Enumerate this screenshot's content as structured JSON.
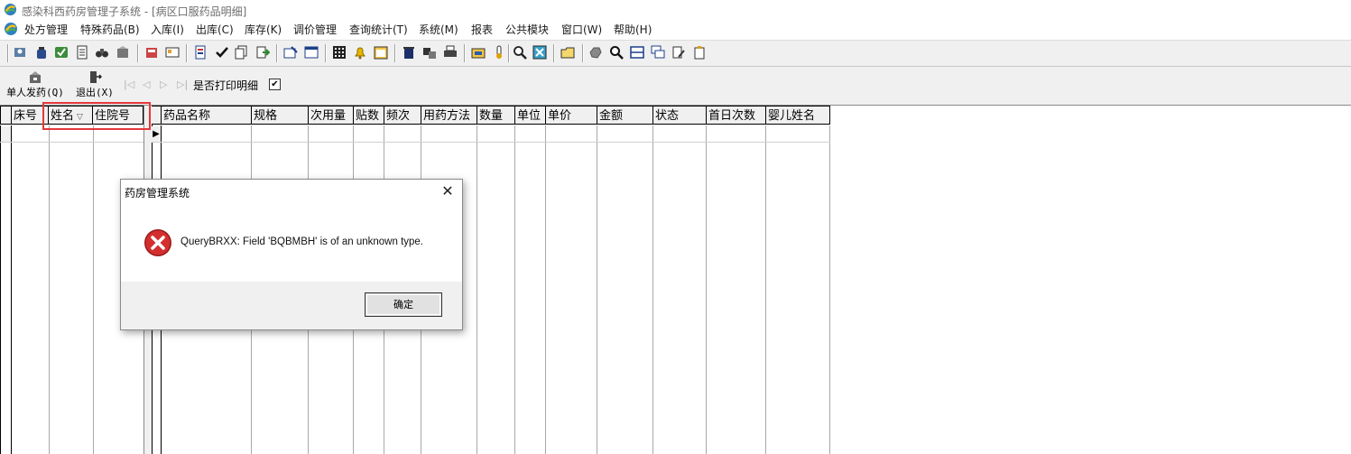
{
  "window": {
    "title": "感染科西药房管理子系统 - [病区口服药品明细]",
    "app_icon": "app-logo-icon"
  },
  "menu": [
    {
      "label": "处方管理"
    },
    {
      "label": "特殊药品(B)"
    },
    {
      "label": "入库(I)"
    },
    {
      "label": "出库(C)"
    },
    {
      "label": "库存(K)"
    },
    {
      "label": "调价管理"
    },
    {
      "label": "查询统计(T)"
    },
    {
      "label": "系统(M)"
    },
    {
      "label": "报表"
    },
    {
      "label": "公共模块"
    },
    {
      "label": "窗口(W)"
    },
    {
      "label": "帮助(H)"
    }
  ],
  "actions": {
    "single_dispense": "单人发药(Q)",
    "exit": "退出(X)",
    "print_detail_label": "是否打印明细",
    "print_detail_checked": true,
    "check_mark": "✔"
  },
  "nav": {
    "first": "|◁",
    "prev": "◁",
    "next": "▷",
    "last": "▷|"
  },
  "patient_table": {
    "columns": [
      "床号",
      "姓名",
      "住院号"
    ],
    "sort_indicator": "▽"
  },
  "drug_table": {
    "columns": [
      "药品名称",
      "规格",
      "次用量",
      "贴数",
      "频次",
      "用药方法",
      "数量",
      "单位",
      "单价",
      "金额",
      "状态",
      "首日次数",
      "婴儿姓名"
    ],
    "row_marker": "▶"
  },
  "dialog": {
    "title": "药房管理系统",
    "message": "QueryBRXX: Field 'BQBMBH' is of an unknown type.",
    "ok_label": "确定",
    "close_glyph": "✕",
    "icon": "error-icon"
  },
  "colors": {
    "highlight": "#e5383b",
    "error_red": "#d32f2f"
  }
}
